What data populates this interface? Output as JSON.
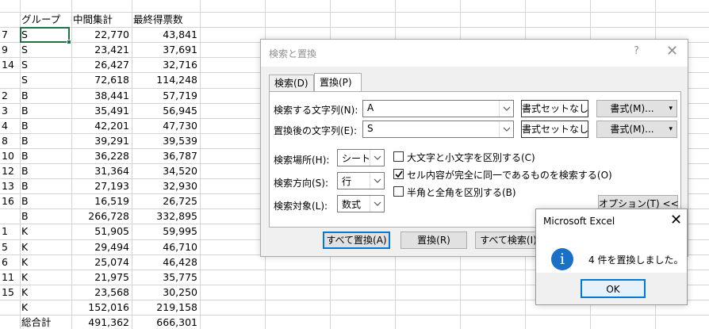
{
  "sheet": {
    "headers": [
      "グループ",
      "中間集計",
      "最終得票数"
    ],
    "rows": [
      {
        "a": "7",
        "b": "S",
        "c": "22,770",
        "d": "43,841"
      },
      {
        "a": "9",
        "b": "S",
        "c": "23,421",
        "d": "37,691"
      },
      {
        "a": "14",
        "b": "S",
        "c": "26,427",
        "d": "32,716"
      },
      {
        "a": "",
        "b": "S",
        "c": "72,618",
        "d": "114,248"
      },
      {
        "a": "2",
        "b": "B",
        "c": "38,441",
        "d": "57,719"
      },
      {
        "a": "3",
        "b": "B",
        "c": "35,491",
        "d": "56,945"
      },
      {
        "a": "4",
        "b": "B",
        "c": "42,201",
        "d": "47,730"
      },
      {
        "a": "8",
        "b": "B",
        "c": "39,291",
        "d": "39,539"
      },
      {
        "a": "10",
        "b": "B",
        "c": "36,228",
        "d": "36,787"
      },
      {
        "a": "12",
        "b": "B",
        "c": "31,364",
        "d": "34,520"
      },
      {
        "a": "13",
        "b": "B",
        "c": "27,193",
        "d": "32,930"
      },
      {
        "a": "16",
        "b": "B",
        "c": "16,519",
        "d": "26,725"
      },
      {
        "a": "",
        "b": "B",
        "c": "266,728",
        "d": "332,895"
      },
      {
        "a": "1",
        "b": "K",
        "c": "51,905",
        "d": "59,995"
      },
      {
        "a": "5",
        "b": "K",
        "c": "29,494",
        "d": "46,710"
      },
      {
        "a": "6",
        "b": "K",
        "c": "25,074",
        "d": "46,428"
      },
      {
        "a": "11",
        "b": "K",
        "c": "21,975",
        "d": "35,775"
      },
      {
        "a": "15",
        "b": "K",
        "c": "23,568",
        "d": "30,250"
      },
      {
        "a": "",
        "b": "K",
        "c": "152,016",
        "d": "219,158"
      },
      {
        "a": "",
        "b": "総合計",
        "c": "491,362",
        "d": "666,301"
      }
    ]
  },
  "dialog": {
    "title": "検索と置換",
    "help": "?",
    "close": "✕",
    "tabs": {
      "find": "検索(D)",
      "replace": "置換(P)"
    },
    "find_label": "検索する文字列(N):",
    "find_value": "A",
    "replace_label": "置換後の文字列(E):",
    "replace_value": "S",
    "no_format_label": "書式セットなし",
    "format_label": "書式(M)...",
    "within_label": "検索場所(H):",
    "within_value": "シート",
    "search_label": "検索方向(S):",
    "search_value": "行",
    "lookin_label": "検索対象(L):",
    "lookin_value": "数式",
    "opt_case": {
      "label": "大文字と小文字を区別する(C)",
      "checked": false
    },
    "opt_whole": {
      "label": "セル内容が完全に同一であるものを検索する(O)",
      "checked": true
    },
    "opt_width": {
      "label": "半角と全角を区別する(B)",
      "checked": false
    },
    "options_button": "オプション(T) <<",
    "replace_all": "すべて置換(A)",
    "replace": "置換(R)",
    "find_all": "すべて検索(I)"
  },
  "msgbox": {
    "title": "Microsoft Excel",
    "close": "✕",
    "icon": "i",
    "text": "4 件を置換しました。",
    "ok": "OK"
  }
}
